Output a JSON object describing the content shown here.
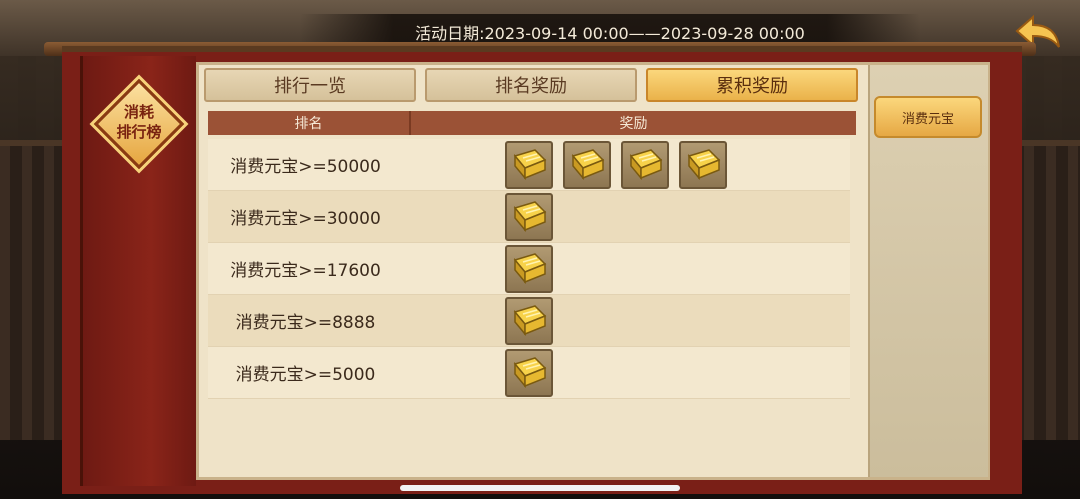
{
  "header": {
    "date_range": "活动日期:2023-09-14 00:00——2023-09-28 00:00"
  },
  "badge": {
    "line1": "消耗",
    "line2": "排行榜"
  },
  "tabs": [
    {
      "label": "排行一览",
      "active": false
    },
    {
      "label": "排名奖励",
      "active": false
    },
    {
      "label": "累积奖励",
      "active": true
    }
  ],
  "table": {
    "col_rank": "排名",
    "col_reward": "奖励",
    "rows": [
      {
        "label": "消费元宝>=50000",
        "item_count": 4
      },
      {
        "label": "消费元宝>=30000",
        "item_count": 1
      },
      {
        "label": "消费元宝>=17600",
        "item_count": 1
      },
      {
        "label": "消费元宝>=8888",
        "item_count": 1
      },
      {
        "label": "消费元宝>=5000",
        "item_count": 1
      }
    ]
  },
  "side": {
    "button_label": "消费元宝"
  },
  "icons": {
    "back": "back-arrow-icon",
    "reward_item": "gold-book-icon"
  },
  "colors": {
    "accent_gold": "#eab24a",
    "frame_red": "#7a1f17",
    "panel_bg": "#efe3c8"
  }
}
